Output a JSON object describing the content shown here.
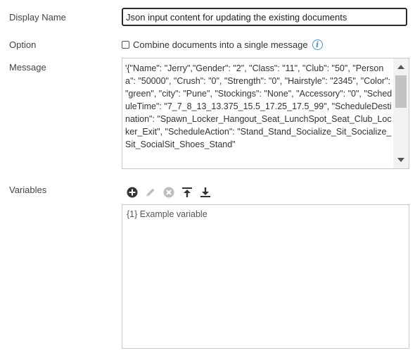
{
  "form": {
    "display_name_label": "Display Name",
    "display_name_value": "Json input content for updating the existing documents",
    "option_label": "Option",
    "option_checkbox_label": "Combine documents into a single message",
    "option_checked": false,
    "message_label": "Message",
    "message_value": "'{\"Name\": \"Jerry\",\"Gender\": \"2\", \"Class\": \"11\", \"Club\": \"50\", \"Persona\": \"50000\", \"Crush\": \"0\", \"Strength\": \"0\", \"Hairstyle\": \"2345\", \"Color\": \"green\", \"city\": \"Pune\", \"Stockings\": \"None\", \"Accessory\": \"0\", \"ScheduleTime\": \"7_7_8_13_13.375_15.5_17.25_17.5_99\", \"ScheduleDestination\": \"Spawn_Locker_Hangout_Seat_LunchSpot_Seat_Club_Locker_Exit\", \"ScheduleAction\": \"Stand_Stand_Socialize_Sit_Socialize_Sit_SocialSit_Shoes_Stand\"",
    "variables_label": "Variables",
    "variables": [
      {
        "text": "{1} Example variable"
      }
    ]
  },
  "icons": {
    "info": "info-icon",
    "add": "plus-circle-icon",
    "edit": "pencil-icon",
    "delete": "x-circle-icon",
    "move_top": "move-to-top-icon",
    "move_bottom": "move-to-bottom-icon"
  },
  "colors": {
    "accent": "#4a90c6",
    "active_icon": "#333333",
    "disabled_icon": "#bdbdbd",
    "border": "#c8c8c8"
  }
}
